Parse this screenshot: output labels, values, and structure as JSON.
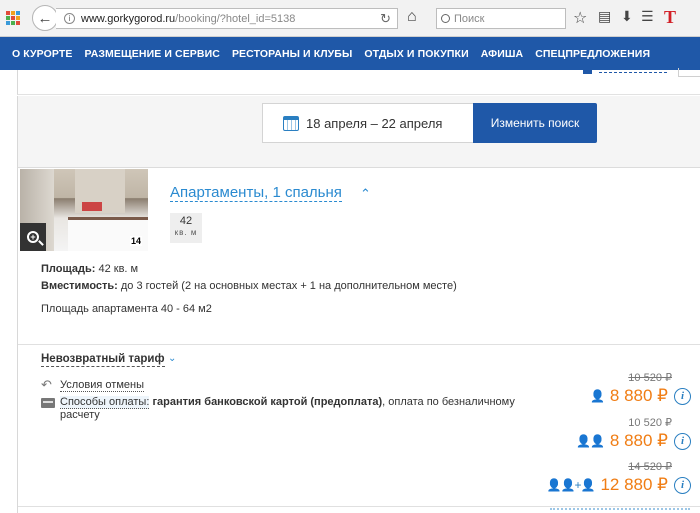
{
  "browser": {
    "url_domain": "www.gorkygorod.ru",
    "url_path": "/booking/?hotel_id=5138",
    "search_placeholder": "Поиск",
    "brand_letter": "T"
  },
  "nav": {
    "items": [
      "О КУРОРТЕ",
      "РАЗМЕЩЕНИЕ И СЕРВИС",
      "РЕСТОРАНЫ И КЛУБЫ",
      "ОТДЫХ И ПОКУПКИ",
      "АФИША",
      "СПЕЦПРЕДЛОЖЕНИЯ"
    ]
  },
  "search": {
    "dates": "18 апреля – 22 апреля",
    "button": "Изменить поиск"
  },
  "room": {
    "title": "Апартаменты, 1 спальня",
    "area_value": "42",
    "area_unit": "кв. м",
    "photo_badge": "14",
    "area_label": "Площадь:",
    "area_text": "42 кв. м",
    "capacity_label": "Вместимость:",
    "capacity_text": "до 3 гостей (2 на основных местах + 1 на дополнительном месте)",
    "extra": "Площадь апартамента 40 - 64 м2"
  },
  "tariff": {
    "name": "Невозвратный тариф",
    "cancel_label": "Условия отмены",
    "payment_label": "Способы оплаты:",
    "payment_bold": "гарантия банковской картой (предоплата)",
    "payment_rest": ", оплата по безналичному расчету",
    "prices": [
      {
        "guests": "1",
        "old": "10 520 ₽",
        "old_struck": true,
        "price": "8 880 ₽"
      },
      {
        "guests": "2",
        "old": "10 520 ₽",
        "old_struck": false,
        "price": "8 880 ₽"
      },
      {
        "guests": "2+1",
        "old": "14 520 ₽",
        "old_struck": true,
        "price": "12 880 ₽"
      }
    ]
  },
  "colors": {
    "nav_bg": "#1f58a8",
    "link": "#2a8ad0",
    "price": "#f07d14"
  }
}
